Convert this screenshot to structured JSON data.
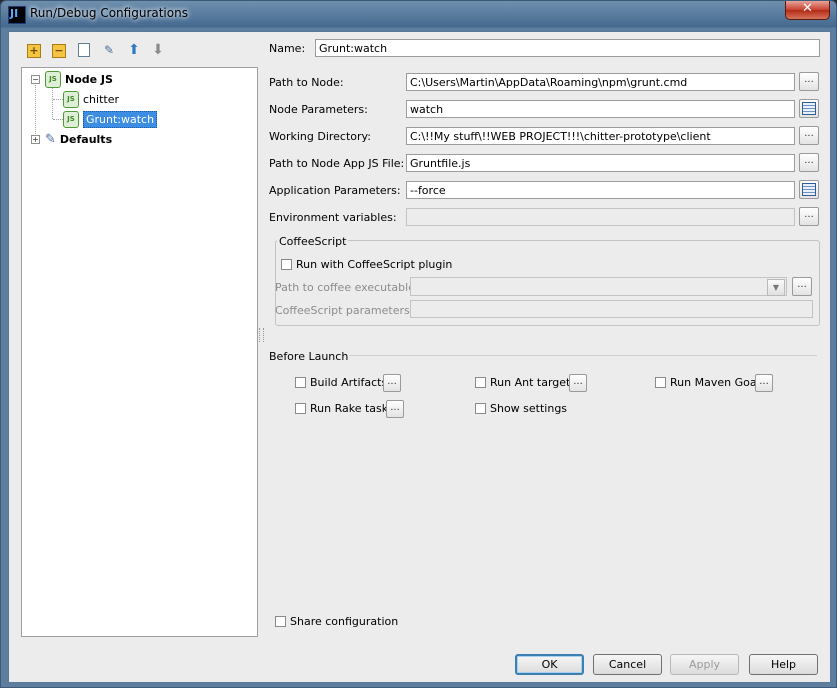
{
  "window": {
    "title": "Run/Debug Configurations",
    "app_icon_glyph": "JI",
    "close_glyph": "✕"
  },
  "toolbar": {
    "add_glyph": "+",
    "remove_glyph": "−",
    "settings_glyph": "✎",
    "up_glyph": "⬆",
    "down_glyph": "⬇"
  },
  "tree": {
    "node_js_label": "Node JS",
    "items": [
      {
        "label": "chitter"
      },
      {
        "label": "Grunt:watch",
        "selected": true
      }
    ],
    "defaults_label": "Defaults",
    "node_icon_text": "JS",
    "expand_minus": "−",
    "expand_plus": "+"
  },
  "form": {
    "name_label": "Name:",
    "name_value": "Grunt:watch",
    "path_to_node_label": "Path to Node:",
    "path_to_node_value": "C:\\Users\\Martin\\AppData\\Roaming\\npm\\grunt.cmd",
    "node_params_label": "Node Parameters:",
    "node_params_value": "watch",
    "working_dir_label": "Working Directory:",
    "working_dir_value": "C:\\!!My stuff\\!!WEB PROJECT!!!\\chitter-prototype\\client",
    "app_js_label": "Path to Node App JS File:",
    "app_js_value": "Gruntfile.js",
    "app_params_label": "Application Parameters:",
    "app_params_value": "--force",
    "env_vars_label": "Environment variables:",
    "env_vars_value": "",
    "browse_glyph": "..."
  },
  "coffeescript": {
    "group_title": "CoffeeScript",
    "run_with_plugin_label": "Run with CoffeeScript plugin",
    "coffee_exec_label": "Path to coffee executable:",
    "coffee_params_label": "CoffeeScript parameters:",
    "combo_arrow": "▼"
  },
  "before_launch": {
    "title": "Before Launch",
    "options": [
      {
        "label": "Build Artifacts"
      },
      {
        "label": "Run Ant target"
      },
      {
        "label": "Run Maven Goal"
      },
      {
        "label": "Run Rake task"
      },
      {
        "label": "Show settings"
      }
    ]
  },
  "share_label": "Share configuration",
  "buttons": {
    "ok": "OK",
    "cancel": "Cancel",
    "apply": "Apply",
    "help": "Help"
  }
}
